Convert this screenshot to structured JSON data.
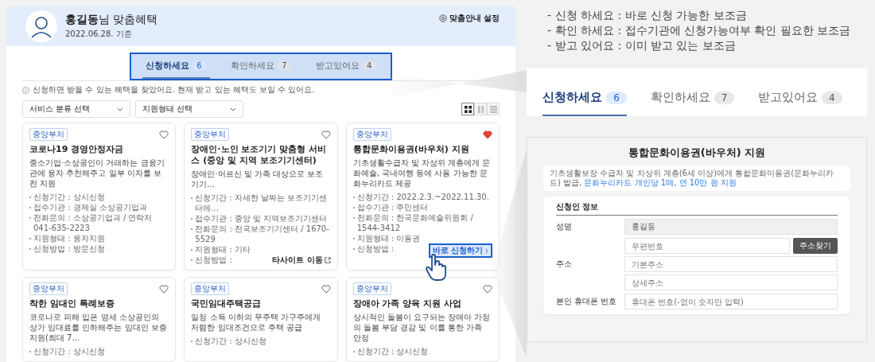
{
  "header": {
    "title": "**홍길동**님 맞춤혜택",
    "date": "2022.06.28. 기준",
    "settings_link": "맞춤안내 설정"
  },
  "tabs": [
    {
      "label": "신청하세요",
      "count": "6",
      "selected": true
    },
    {
      "label": "확인하세요",
      "count": "7",
      "selected": false
    },
    {
      "label": "받고있어요",
      "count": "4",
      "selected": false
    }
  ],
  "notice": "신청하면 받을 수 있는 혜택을 찾았어요. 현재 받고 있는 혜택도 보일 수 있어요.",
  "filters": [
    {
      "label": "서비스 분류 선택"
    },
    {
      "label": "지원형태 선택"
    }
  ],
  "view_modes": [
    {
      "kind": "grid",
      "selected": true
    },
    {
      "kind": "columns",
      "selected": false
    },
    {
      "kind": "list",
      "selected": false
    }
  ],
  "cards": [
    {
      "agency": "중앙부처",
      "title": "코로나19 경영안정자금",
      "favorite": false,
      "description": "중소기업·소상공인이 거래하는 금융기관에 융자 추천해주고 일부 이자를 보전 지원",
      "details": [
        {
          "kind": "text",
          "text": "신청기간 : 상시신청"
        },
        {
          "kind": "text",
          "text": "접수기관 : 경제실 소상공기업과"
        },
        {
          "kind": "text",
          "text": "전화문의 : 소상공기업과 / 연락처 041-635-2223"
        },
        {
          "kind": "text",
          "text": "지원형태 : 융자지원"
        },
        {
          "kind": "text",
          "text": "신청방법 : 방문신청"
        }
      ]
    },
    {
      "agency": "중앙부처",
      "title": "장애인·노인 보조기기 맞춤형 서비스 (중앙 및 지역 보조기기센터)",
      "favorite": false,
      "description": "장애인·어르신 및 가족 대상으로 보조기기...",
      "details": [
        {
          "kind": "text",
          "text": "신청기간 : 자세한 날짜는 보조기기센터에..."
        },
        {
          "kind": "text",
          "text": "접수기관 : 중앙 및 지역보조기기센터"
        },
        {
          "kind": "text",
          "text": "전화문의 : 전국보조기기센터 / 1670-5529"
        },
        {
          "kind": "text",
          "text": "지원형태 : 기타"
        },
        {
          "kind": "link",
          "text": "신청방법 :",
          "action": "타사이트 이동"
        }
      ]
    },
    {
      "agency": "중앙부처",
      "title": "통합문화이용권(바우처) 지원",
      "favorite": true,
      "description": "기초생활수급자 및 차상위 계층에게 문화예술, 국내여행 등에 사용 가능한 문화누리카드 제공",
      "details": [
        {
          "kind": "text",
          "text": "신청기간 : 2022.2.3.~2022.11.30."
        },
        {
          "kind": "text",
          "text": "접수기관 : 주민센터"
        },
        {
          "kind": "text",
          "text": "전화문의 : 한국문화예술위원회 / 1544-3412"
        },
        {
          "kind": "text",
          "text": "지원형태 : 이용권"
        },
        {
          "kind": "button",
          "text": "신청방법 :",
          "action": "바로 신청하기"
        }
      ]
    },
    {
      "agency": "중앙부처",
      "title": "착한 임대인 특례보증",
      "favorite": false,
      "description": "코로나로 피해 입은 영세 소상공인의 상가 임대료를 인하해주는 임대인 보증지원(최대 7...",
      "details": [
        {
          "kind": "text",
          "text": "신청기간 : 상시신청"
        }
      ]
    },
    {
      "agency": "중앙부처",
      "title": "국민임대주택공급",
      "favorite": false,
      "description": "일정 소득 이하의 무주택 가구주에게 저렴한 임대조건으로 주택 공급",
      "details": [
        {
          "kind": "text",
          "text": "신청기간 : 상시신청"
        }
      ]
    },
    {
      "agency": "중앙부처",
      "title": "장애아 가족 양육 지원 사업",
      "favorite": false,
      "description": "상시적인 돌봄이 요구되는 장애아 가정의 돌봄 부담 경감 및 이를 통한 가족 안정",
      "details": [
        {
          "kind": "text",
          "text": "신청기간 : 상시신청"
        }
      ]
    }
  ],
  "legend": [
    "- 신청 하세요 : 바로 신청 가능한 보조금",
    "- 확인 하세요 : 접수기관에 신청가능여부 확인 필요한 보조금",
    "- 받고 있어요 : 이미 받고 있는 보조금"
  ],
  "zoom_tabs": [
    {
      "label": "신청하세요",
      "count": "6",
      "selected": true
    },
    {
      "label": "확인하세요",
      "count": "7",
      "selected": false
    },
    {
      "label": "받고있어요",
      "count": "4",
      "selected": false
    }
  ],
  "form": {
    "title": "통합문화이용권(바우처) 지원",
    "description": "기초생활보장 수급자 및 차상위 계층(6세 이상)에게 통합문화이용권(문화누리카드) 발급,",
    "description_link": "문화누리카드 개인당 1매, 연 10만 원 지원",
    "section_title": "신청인 정보",
    "fields": [
      {
        "label": "성명",
        "inputs": [
          {
            "value": "홍길동",
            "disabled": true
          }
        ]
      },
      {
        "label": "주소",
        "inputs": [
          {
            "placeholder": "우편번호",
            "disabled": false,
            "button": "주소찾기"
          },
          {
            "placeholder": "기본주소",
            "disabled": false
          },
          {
            "placeholder": "상세주소",
            "disabled": false
          }
        ]
      },
      {
        "label": "본인 휴대폰 번호",
        "inputs": [
          {
            "placeholder": "휴대폰 번호(-없이 숫자만 입력)",
            "disabled": false
          }
        ]
      }
    ]
  }
}
